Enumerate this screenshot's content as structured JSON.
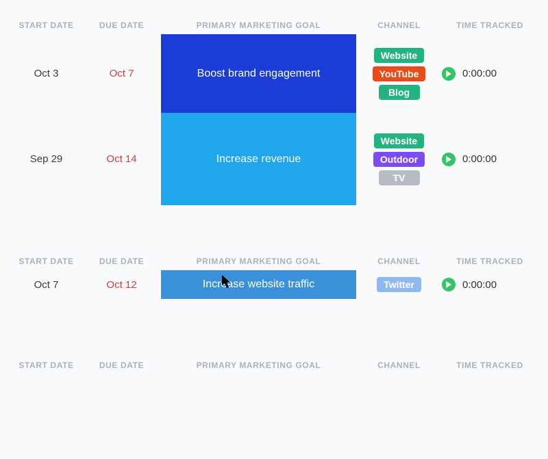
{
  "columns": {
    "start": "START DATE",
    "due": "DUE DATE",
    "goal": "PRIMARY MARKETING GOAL",
    "channel": "CHANNEL",
    "time": "TIME TRACKED"
  },
  "chip_colors": {
    "Website": "#23b381",
    "YouTube": "#ea4b1a",
    "Blog": "#23b381",
    "Outdoor": "#7c4cf0",
    "TV": "#b6bcc2",
    "Twitter": "#8fb8f1"
  },
  "sections": [
    {
      "rows": [
        {
          "start": "Oct 3",
          "due": "Oct 7",
          "goal": "Boost brand engagement",
          "goal_color": "#1c3cd6",
          "goal_size": "goal-tall",
          "channels": [
            "Website",
            "YouTube",
            "Blog"
          ],
          "time": "0:00:00"
        },
        {
          "start": "Sep 29",
          "due": "Oct 14",
          "goal": "Increase revenue",
          "goal_color": "#1fa6ec",
          "goal_size": "goal-tall2",
          "channels": [
            "Website",
            "Outdoor",
            "TV"
          ],
          "time": "0:00:00"
        }
      ]
    },
    {
      "rows": [
        {
          "start": "Oct 7",
          "due": "Oct 12",
          "goal": "Increase website traffic",
          "goal_color": "#3a91d9",
          "goal_size": "goal-short",
          "channels": [
            "Twitter"
          ],
          "time": "0:00:00"
        }
      ]
    },
    {
      "rows": []
    }
  ]
}
